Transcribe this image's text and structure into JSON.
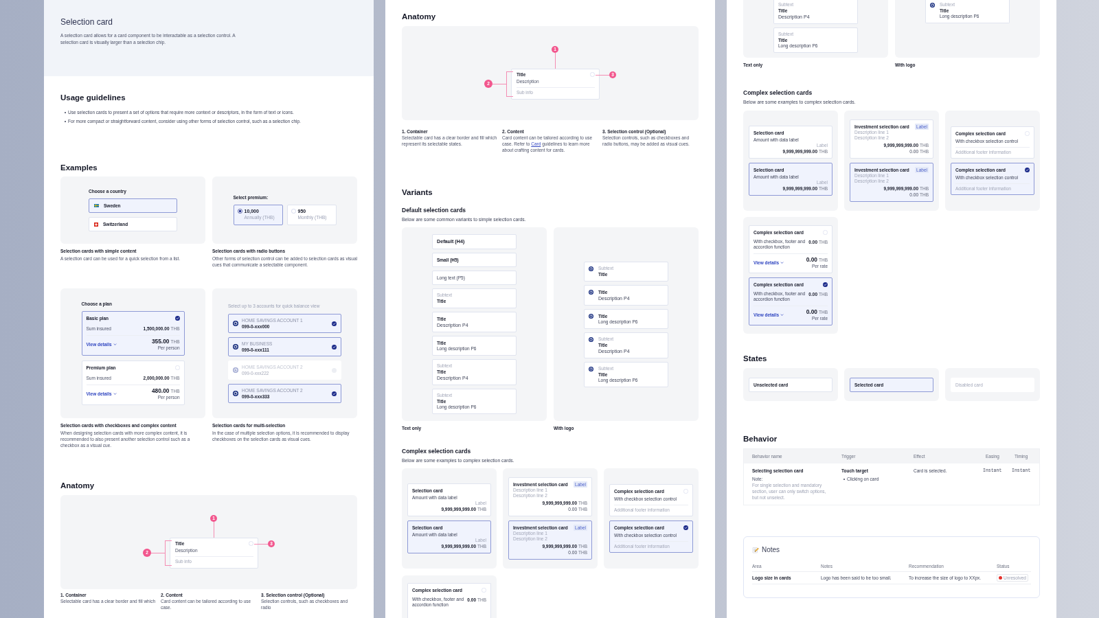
{
  "panels": [
    {
      "hero": {
        "title": "Selection card",
        "description": "A selection card allows for a card component to be interactable as a selection control. A selection card is visually larger than a selection chip."
      },
      "usage": {
        "heading": "Usage guidelines",
        "bullets": [
          "Use selection cards to present a set of options that require more context or descriptors, in the form of text or icons.",
          "For more compact or straightforward content, consider using other forms of selection control, such as a selection chip."
        ]
      },
      "examples": {
        "heading": "Examples",
        "items": [
          {
            "kind": "country_list",
            "label": "Choose a country",
            "options": [
              {
                "name": "Sweden",
                "selected": true
              },
              {
                "name": "Switzerland",
                "selected": false
              }
            ],
            "caption": {
              "title": "Selection cards with simple content",
              "description": "A selection card can be used for a quick selection from a list."
            }
          },
          {
            "kind": "radio_cards",
            "label": "Select premium:",
            "options": [
              {
                "amount": "10,000",
                "period": "Annually (THB)",
                "selected": true
              },
              {
                "amount": "950",
                "period": "Monthly (THB)",
                "selected": false
              }
            ],
            "caption": {
              "title": "Selection cards with radio buttons",
              "description": "Other forms of selection control can be added to selection cards as visual cues that communicate a selectable component."
            }
          },
          {
            "kind": "plan_cards",
            "label": "Choose a plan",
            "plans": [
              {
                "name": "Basic plan",
                "selected": true,
                "sum_label": "Sum insured",
                "sum": "1,500,000.00",
                "sum_unit": "THB",
                "link": "View details",
                "price": "355.00",
                "price_unit": "THB",
                "price_note": "Per person"
              },
              {
                "name": "Premium plan",
                "selected": false,
                "sum_label": "Sum insured",
                "sum": "2,000,000.00",
                "sum_unit": "THB",
                "link": "View details",
                "price": "480.00",
                "price_unit": "THB",
                "price_note": "Per person"
              }
            ],
            "caption": {
              "title": "Selection cards with checkboxes and complex content",
              "description": "When designing selection cards with more complex content, it is recommended to also present another selection control such as a checkbox as a visual cue."
            }
          },
          {
            "kind": "account_cards",
            "label": "Select up to 3 accounts for quick balance view",
            "accounts": [
              {
                "name": "HOME SAVINGS ACCOUNT 1",
                "number": "099-0-xxx000",
                "selected": true,
                "disabled": false
              },
              {
                "name": "MY BUSINESS",
                "number": "099-0-xxx111",
                "selected": true,
                "disabled": false
              },
              {
                "name": "HOME SAVINGS ACCOUNT 2",
                "number": "099-0-xxx222",
                "selected": false,
                "disabled": true
              },
              {
                "name": "HOME SAVINGS ACCOUNT 2",
                "number": "099-0-xxx333",
                "selected": true,
                "disabled": false
              }
            ],
            "caption": {
              "title": "Selection cards for multi-selection",
              "description": "In the case of multiple selection options, it is recommended to display checkboxes on the selection cards as visual cues."
            }
          }
        ]
      },
      "anatomy": {
        "heading": "Anatomy",
        "diagram": {
          "title": "Title",
          "description": "Description",
          "sub_info": "Sub info",
          "markers": [
            "1",
            "2",
            "3"
          ]
        },
        "parts": [
          {
            "title": "1. Container",
            "segments": [
              {
                "kind": "text",
                "text": "Selectable card has a clear border and fill which"
              }
            ]
          },
          {
            "title": "2. Content",
            "segments": [
              {
                "kind": "text",
                "text": "Card content can be tailored according to use case."
              }
            ]
          },
          {
            "title": "3. Selection control (Optional)",
            "segments": [
              {
                "kind": "text",
                "text": "Selection controls, such as checkboxes and radio"
              }
            ]
          }
        ]
      }
    },
    {
      "anatomy": {
        "heading": "Anatomy",
        "diagram": {
          "title": "Title",
          "description": "Description",
          "sub_info": "Sub info",
          "markers": [
            "1",
            "2",
            "3"
          ]
        },
        "parts": [
          {
            "title": "1. Container",
            "segments": [
              {
                "kind": "text",
                "text": "Selectable card has a clear border and fill which represent its selectable states."
              }
            ]
          },
          {
            "title": "2. Content",
            "segments": [
              {
                "kind": "text",
                "text": "Card content can be tailored according to use case. Refer to "
              },
              {
                "kind": "link",
                "text": "Card"
              },
              {
                "kind": "text",
                "text": " guidelines to learn more about crafting content for cards."
              }
            ]
          },
          {
            "title": "3. Selection control (Optional)",
            "segments": [
              {
                "kind": "text",
                "text": "Selection controls, such as checkboxes and radio buttons, may be added as visual cues."
              }
            ]
          }
        ]
      },
      "variants": {
        "heading": "Variants",
        "subheading": "Default selection cards",
        "description": "Below are some common variants to simple selection cards.",
        "groups": [
          {
            "caption": "Text only",
            "logo": false,
            "cards": [
              {
                "lines": [
                  {
                    "kind": "h4",
                    "text": "Default (H4)"
                  }
                ]
              },
              {
                "lines": [
                  {
                    "kind": "h5",
                    "text": "Small (H5)"
                  }
                ]
              },
              {
                "lines": [
                  {
                    "kind": "p5",
                    "text": "Long text (P5)"
                  }
                ]
              },
              {
                "lines": [
                  {
                    "kind": "subtext",
                    "text": "Subtext"
                  },
                  {
                    "kind": "title",
                    "text": "Title"
                  }
                ]
              },
              {
                "lines": [
                  {
                    "kind": "title",
                    "text": "Title"
                  },
                  {
                    "kind": "p4",
                    "text": "Description P4"
                  }
                ]
              },
              {
                "lines": [
                  {
                    "kind": "title",
                    "text": "Title"
                  },
                  {
                    "kind": "p6",
                    "text": "Long description P6"
                  }
                ]
              },
              {
                "lines": [
                  {
                    "kind": "subtext",
                    "text": "Subtext"
                  },
                  {
                    "kind": "title",
                    "text": "Title"
                  },
                  {
                    "kind": "p4",
                    "text": "Description P4"
                  }
                ]
              },
              {
                "lines": [
                  {
                    "kind": "subtext",
                    "text": "Subtext"
                  },
                  {
                    "kind": "title",
                    "text": "Title"
                  },
                  {
                    "kind": "p6",
                    "text": "Long description P6"
                  }
                ]
              }
            ]
          },
          {
            "caption": "With logo",
            "logo": true,
            "cards": [
              {
                "lines": [
                  {
                    "kind": "subtext",
                    "text": "Subtext"
                  },
                  {
                    "kind": "title",
                    "text": "Title"
                  }
                ]
              },
              {
                "lines": [
                  {
                    "kind": "title",
                    "text": "Title"
                  },
                  {
                    "kind": "p4",
                    "text": "Description P4"
                  }
                ]
              },
              {
                "lines": [
                  {
                    "kind": "title",
                    "text": "Title"
                  },
                  {
                    "kind": "p6",
                    "text": "Long description P6"
                  }
                ]
              },
              {
                "lines": [
                  {
                    "kind": "subtext",
                    "text": "Subtext"
                  },
                  {
                    "kind": "title",
                    "text": "Title"
                  },
                  {
                    "kind": "p4",
                    "text": "Description P4"
                  }
                ]
              },
              {
                "lines": [
                  {
                    "kind": "subtext",
                    "text": "Subtext"
                  },
                  {
                    "kind": "title",
                    "text": "Title"
                  },
                  {
                    "kind": "p6",
                    "text": "Long description P6"
                  }
                ]
              }
            ]
          }
        ]
      },
      "complex": {
        "heading": "Complex selection cards",
        "description": "Below are some examples to complex selection cards.",
        "groups": [
          {
            "kind": "amount",
            "cards": [
              {
                "title": "Selection card",
                "subtitle": "Amount with data label",
                "label": "Label",
                "amount": "9,999,999,999.00",
                "unit": "THB",
                "selected": false
              },
              {
                "title": "Selection card",
                "subtitle": "Amount with data label",
                "label": "Label",
                "amount": "9,999,999,999.00",
                "unit": "THB",
                "selected": true
              }
            ]
          },
          {
            "kind": "investment",
            "cards": [
              {
                "title": "Investment selection card",
                "tag": "Label",
                "lines": [
                  "Description line 1",
                  "Description line 2"
                ],
                "amount": "9,999,999,999.00",
                "unit": "THB",
                "secondary": "0.00",
                "secondary_unit": "THB",
                "selected": false
              },
              {
                "title": "Investment selection card",
                "tag": "Label",
                "lines": [
                  "Description line 1",
                  "Description line 2"
                ],
                "amount": "9,999,999,999.00",
                "unit": "THB",
                "secondary": "0.00",
                "secondary_unit": "THB",
                "selected": true
              }
            ]
          },
          {
            "kind": "footer",
            "cards": [
              {
                "title": "Complex selection card",
                "description": "With checkbox selection control",
                "footer": "Additional footer information",
                "selected": false
              },
              {
                "title": "Complex selection card",
                "description": "With checkbox selection control",
                "footer": "Additional footer information",
                "selected": true
              }
            ]
          },
          {
            "kind": "accordion",
            "cards": [
              {
                "title": "Complex selection card",
                "description": "With checkbox, footer and accordion function",
                "amount": "0.00",
                "unit": "THB",
                "selected": false
              }
            ]
          }
        ]
      }
    },
    {
      "variants": {
        "groups": [
          {
            "caption": "Text only",
            "logo": false,
            "cards": [
              {
                "lines": [
                  {
                    "kind": "subtext",
                    "text": "Subtext"
                  },
                  {
                    "kind": "title",
                    "text": "Title"
                  },
                  {
                    "kind": "p4",
                    "text": "Description P4"
                  }
                ]
              },
              {
                "lines": [
                  {
                    "kind": "subtext",
                    "text": "Subtext"
                  },
                  {
                    "kind": "title",
                    "text": "Title"
                  },
                  {
                    "kind": "p6",
                    "text": "Long description P6"
                  }
                ]
              }
            ]
          },
          {
            "caption": "With logo",
            "logo": true,
            "cards": [
              {
                "lines": [
                  {
                    "kind": "subtext",
                    "text": "Subtext"
                  },
                  {
                    "kind": "title",
                    "text": "Title"
                  },
                  {
                    "kind": "p6",
                    "text": "Long description P6"
                  }
                ]
              }
            ]
          }
        ]
      },
      "complex": {
        "heading": "Complex selection cards",
        "description": "Below are some examples to complex selection cards.",
        "groups": [
          {
            "kind": "amount",
            "cards": [
              {
                "title": "Selection card",
                "subtitle": "Amount with data label",
                "label": "Label",
                "amount": "9,999,999,999.00",
                "unit": "THB",
                "selected": false
              },
              {
                "title": "Selection card",
                "subtitle": "Amount with data label",
                "label": "Label",
                "amount": "9,999,999,999.00",
                "unit": "THB",
                "selected": true
              }
            ]
          },
          {
            "kind": "investment",
            "cards": [
              {
                "title": "Investment selection card",
                "tag": "Label",
                "lines": [
                  "Description line 1",
                  "Description line 2"
                ],
                "amount": "9,999,999,999.00",
                "unit": "THB",
                "secondary": "0.00",
                "secondary_unit": "THB",
                "selected": false
              },
              {
                "title": "Investment selection card",
                "tag": "Label",
                "lines": [
                  "Description line 1",
                  "Description line 2"
                ],
                "amount": "9,999,999,999.00",
                "unit": "THB",
                "secondary": "0.00",
                "secondary_unit": "THB",
                "selected": true
              }
            ]
          },
          {
            "kind": "footer",
            "cards": [
              {
                "title": "Complex selection card",
                "description": "With checkbox selection control",
                "footer": "Additional footer information",
                "selected": false
              },
              {
                "title": "Complex selection card",
                "description": "With checkbox selection control",
                "footer": "Additional footer information",
                "selected": true
              }
            ]
          },
          {
            "kind": "accordion",
            "cards": [
              {
                "title": "Complex selection card",
                "description": "With checkbox, footer and accordion function",
                "amount": "0.00",
                "unit": "THB",
                "link": "View details",
                "total": "0.00",
                "total_unit": "THB",
                "note": "Per rate",
                "selected": false
              },
              {
                "title": "Complex selection card",
                "description": "With checkbox, footer and accordion function",
                "amount": "0.00",
                "unit": "THB",
                "link": "View details",
                "total": "0.00",
                "total_unit": "THB",
                "note": "Per rate",
                "selected": true
              }
            ]
          }
        ]
      },
      "states": {
        "heading": "States",
        "cards": [
          {
            "label": "Unselected card",
            "selected": false,
            "disabled": false
          },
          {
            "label": "Selected card",
            "selected": true,
            "disabled": false
          },
          {
            "label": "Disabled card",
            "selected": false,
            "disabled": true
          }
        ]
      },
      "behavior": {
        "heading": "Behavior",
        "columns": [
          "Behavior name",
          "Trigger",
          "Effect",
          "Easing",
          "Timing"
        ],
        "rows": [
          {
            "name": "Selecting selection card",
            "note_label": "Note:",
            "note": "For single selection and mandatory section, user can only switch options, but not unselect.",
            "trigger": "Touch target",
            "trigger_items": [
              "Clicking on card"
            ],
            "effect": "Card is selected.",
            "easing": "Instant",
            "timing": "Instant"
          }
        ]
      },
      "notes": {
        "title": "Notes",
        "columns": [
          "Area",
          "Notes",
          "Recommendation",
          "Status"
        ],
        "rows": [
          {
            "area": "Logo size in cards",
            "note": "Logo has been said to be too small.",
            "recommendation": "To increase the size of logo to XXpx.",
            "status": "Unresolved",
            "color": "#e5322d"
          }
        ]
      }
    }
  ]
}
